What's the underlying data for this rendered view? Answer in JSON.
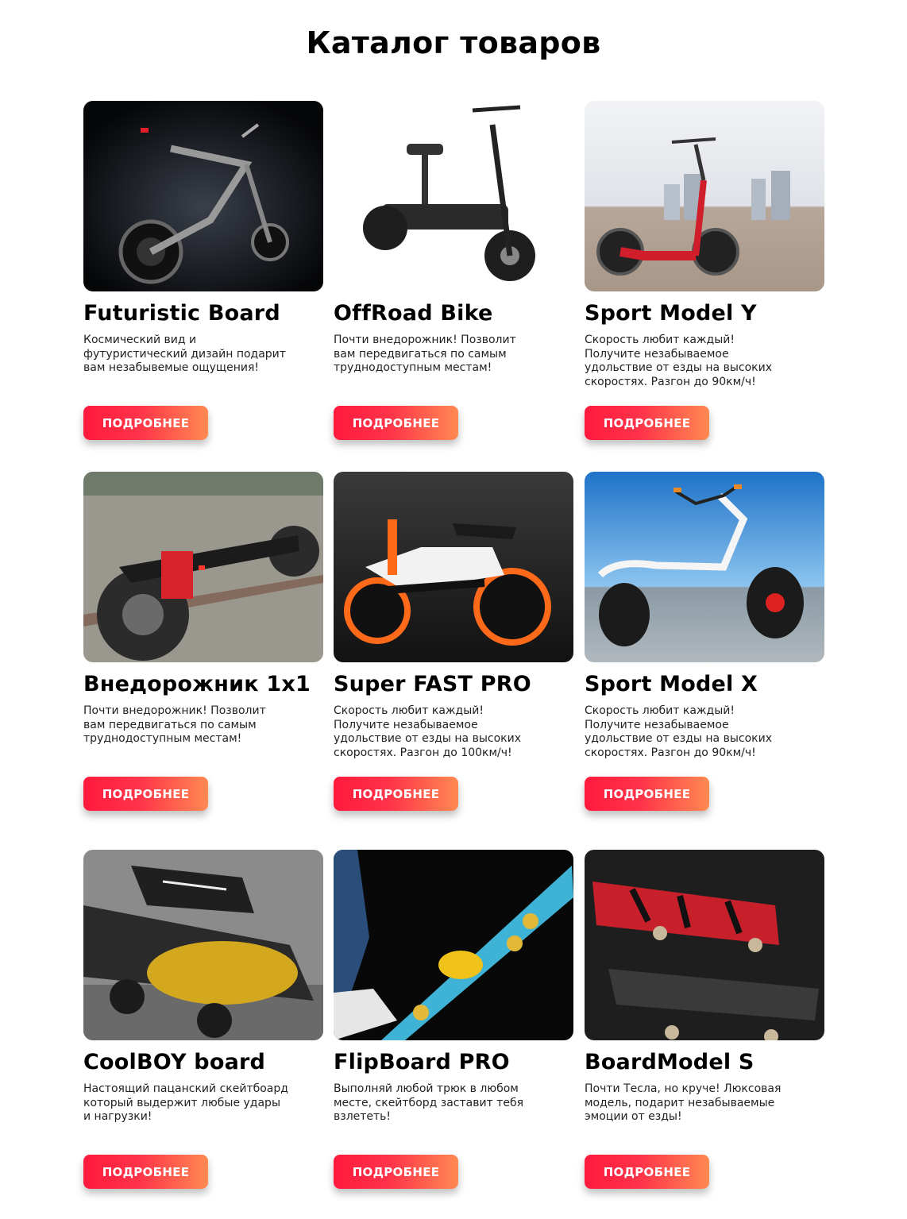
{
  "page": {
    "title": "Каталог товаров"
  },
  "button_label": "ПОДРОБНЕЕ",
  "products": [
    {
      "name": "Futuristic Board",
      "description": "Космический вид и футуристический дизайн подарит вам незабывемые ощущения!"
    },
    {
      "name": "OffRoad Bike",
      "description": "Почти внедорожник! Позволит вам передвигаться по самым труднодоступным местам!"
    },
    {
      "name": "Sport Model Y",
      "description": "Скорость любит каждый! Получите незабываемое удольствие от езды на высоких скоростях. Разгон до 90км/ч!"
    },
    {
      "name": "Внедорожник 1x1",
      "description": "Почти внедорожник! Позволит вам передвигаться по самым труднодоступным местам!"
    },
    {
      "name": "Super FAST PRO",
      "description": "Скорость любит каждый! Получите незабываемое удольствие от езды на высоких скоростях. Разгон до 100км/ч!"
    },
    {
      "name": "Sport Model X",
      "description": "Скорость любит каждый! Получите незабываемое удольствие от езды на высоких скоростях. Разгон до 90км/ч!"
    },
    {
      "name": "CoolBOY board",
      "description": "Настоящий пацанский скейтбоард который выдержит любые удары и нагрузки!"
    },
    {
      "name": "FlipBoard PRO",
      "description": "Выполняй любой трюк в любом месте, скейтборд заставит тебя взлететь!"
    },
    {
      "name": "BoardModel S",
      "description": "Почти Тесла, но круче! Люксовая модель, подарит незабываемые эмоции от езды!"
    }
  ]
}
